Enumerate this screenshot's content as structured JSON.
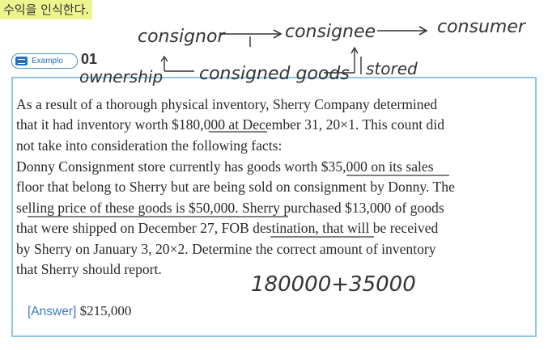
{
  "header": {
    "korean_title": "수익을 인식한다."
  },
  "example": {
    "label": "Examplo",
    "number": "01"
  },
  "problem": {
    "paragraph1": [
      "As a result of a thorough physical inventory, Sherry Company determined",
      "that it had inventory worth $180,000 at December 31, 20×1. This count did",
      "not take into consideration the following facts:"
    ],
    "paragraph2": [
      "Donny Consignment store currently has goods worth $35,000 on its sales",
      "floor that belong to Sherry but are being sold on consignment by Donny. The",
      "selling price of these goods is $50,000. Sherry purchased $13,000 of goods",
      "that were shipped on December 27, FOB destination, that will be received",
      "by Sherry on January 3, 20×2. Determine the correct amount of inventory",
      "that Sherry should report."
    ]
  },
  "answer": {
    "label": "[Answer]",
    "value": "$215,000"
  },
  "handwriting": {
    "consignor": "consignor",
    "consignee": "consignee",
    "consumer": "consumer",
    "ownership": "ownership",
    "consigned_goods": "consigned goods",
    "stored": "stored",
    "calculation": "180000+35000"
  }
}
